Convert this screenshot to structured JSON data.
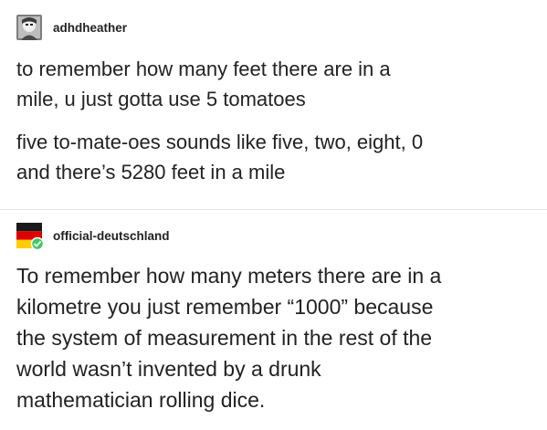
{
  "posts": [
    {
      "username": "adhdheather",
      "avatar_icon": "user-avatar-icon",
      "paragraphs": [
        [
          "to remember how many feet there are in a",
          "mile, u just gotta use 5 tomatoes"
        ],
        [
          "five to-mate-oes sounds like five, two, eight, 0",
          "and there’s 5280 feet in a mile"
        ]
      ]
    },
    {
      "username": "official-deutschland",
      "avatar_icon": "germany-flag-avatar-icon",
      "paragraphs": [
        [
          "To remember how many meters there are in a",
          "kilometre you just remember “1000” because",
          "the system of measurement in the rest of the",
          "world wasn’t invented by a drunk",
          "mathematician rolling dice."
        ]
      ]
    }
  ],
  "colors": {
    "text": "#222222",
    "divider": "#e4e4e4",
    "badge": "#44c767"
  }
}
